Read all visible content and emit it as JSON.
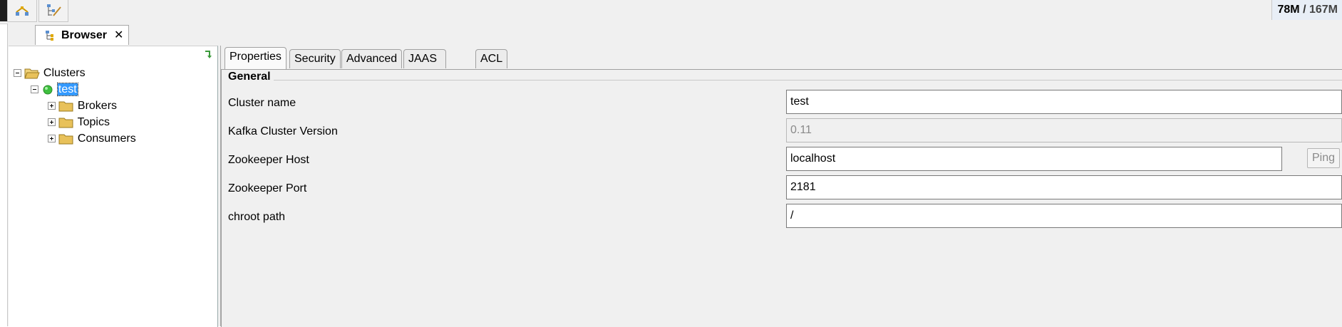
{
  "toolbar": {
    "buttons": [
      {
        "icon": "connect-cluster-icon"
      },
      {
        "icon": "edit-tree-icon"
      }
    ],
    "memory_used": "78M",
    "memory_separator": " / ",
    "memory_total": "167M"
  },
  "view_tab": {
    "label": "Browser",
    "close": "✕"
  },
  "tree": {
    "root": "Clusters",
    "cluster": "test",
    "cluster_status_color": "#3fbf3f",
    "children": [
      "Brokers",
      "Topics",
      "Consumers"
    ]
  },
  "tabs": [
    "Properties",
    "Security",
    "Advanced",
    "JAAS Config",
    "ACL"
  ],
  "active_tab": "Properties",
  "general": {
    "title": "General",
    "fields": [
      {
        "label": "Cluster name",
        "value": "test",
        "enabled": true
      },
      {
        "label": "Kafka Cluster Version",
        "value": "0.11",
        "enabled": false
      },
      {
        "label": "Zookeeper Host",
        "value": "localhost",
        "enabled": true
      },
      {
        "label": "Zookeeper Port",
        "value": "2181",
        "enabled": true
      },
      {
        "label": "chroot path",
        "value": "/",
        "enabled": true
      }
    ],
    "ping_label": "Ping"
  },
  "colors": {
    "selection": "#3399ff",
    "folder": "#e8c15a"
  }
}
